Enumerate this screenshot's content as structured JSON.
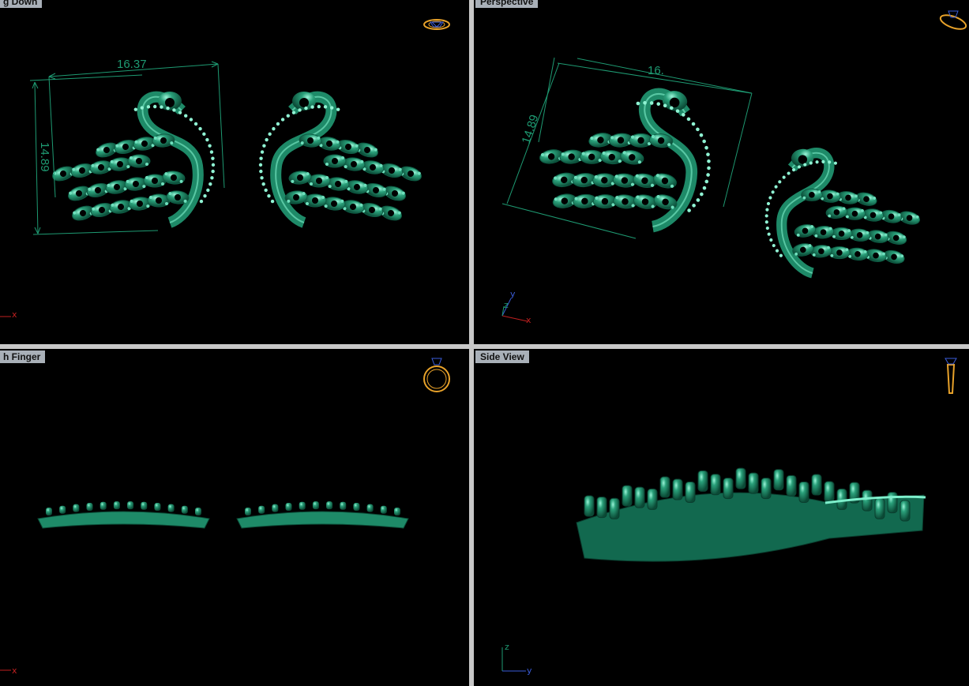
{
  "viewports": {
    "top_left": {
      "label": "g Down"
    },
    "top_right": {
      "label": "Perspective"
    },
    "bottom_left": {
      "label": "h Finger"
    },
    "bottom_right": {
      "label": "Side View"
    }
  },
  "dimensions": {
    "top_width": "16.37",
    "top_height": "14.89",
    "persp_width": "16.",
    "persp_height": "14.89"
  },
  "axes": {
    "x": "x",
    "y": "y",
    "z": "z"
  },
  "icons": {
    "top_left": "ring-top-view-icon",
    "top_right": "ring-perspective-icon",
    "bottom_left": "ring-front-view-icon",
    "bottom_right": "ring-side-view-icon"
  },
  "colors": {
    "model": "#1e8a68",
    "model_highlight": "#7ef0cc",
    "dimension": "#1e9a72",
    "background": "#000000",
    "frame": "#c8c8c8",
    "tag_bg": "#a9b0b8",
    "widget_orange": "#e8a22a",
    "widget_blue": "#3a5cd8",
    "axis_red": "#c02020"
  }
}
